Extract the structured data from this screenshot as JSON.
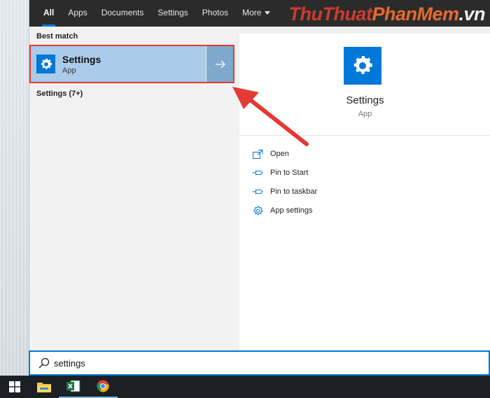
{
  "nav": {
    "tabs": [
      {
        "label": "All"
      },
      {
        "label": "Apps"
      },
      {
        "label": "Documents"
      },
      {
        "label": "Settings"
      },
      {
        "label": "Photos"
      },
      {
        "label": "More"
      }
    ],
    "watermark": {
      "part1": "Thu",
      "part2": "Thuat",
      "part3": "PhanMem",
      "part4": ".vn"
    }
  },
  "left": {
    "best_match_label": "Best match",
    "result": {
      "title": "Settings",
      "subtitle": "App"
    },
    "more_label": "Settings (7+)"
  },
  "right": {
    "app_name": "Settings",
    "app_type": "App",
    "actions": [
      {
        "label": "Open",
        "icon": "open-icon"
      },
      {
        "label": "Pin to Start",
        "icon": "pin-icon"
      },
      {
        "label": "Pin to taskbar",
        "icon": "pin-icon"
      },
      {
        "label": "App settings",
        "icon": "gear-icon"
      }
    ]
  },
  "search": {
    "value": "settings",
    "icon": "search-icon"
  },
  "taskbar": {
    "items": [
      {
        "icon": "windows-start-icon"
      },
      {
        "icon": "file-explorer-icon"
      },
      {
        "icon": "excel-icon"
      },
      {
        "icon": "chrome-icon"
      }
    ]
  },
  "colors": {
    "accent": "#0078d7",
    "selection": "#aacbe9",
    "annotation": "#e53935"
  }
}
